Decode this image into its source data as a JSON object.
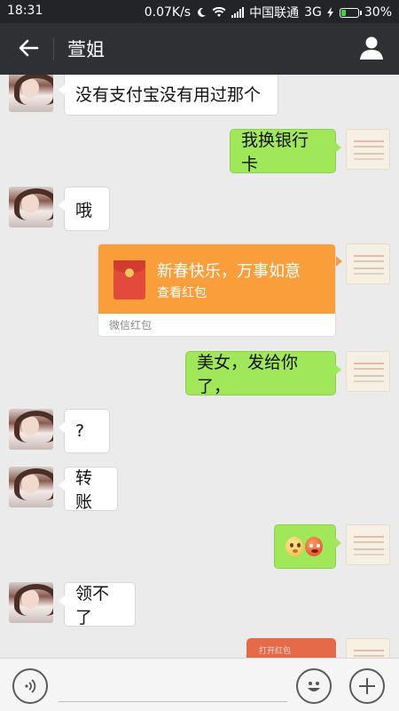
{
  "status_bar": {
    "time": "18:31",
    "network_speed": "0.07K/s",
    "carrier": "中国联通",
    "network_type": "3G",
    "battery": "30%",
    "battery_level": 0.3
  },
  "header": {
    "title": "萱姐",
    "back_icon": "arrow-left-icon",
    "profile_icon": "person-icon"
  },
  "messages": [
    {
      "from": "contact",
      "text": "没有支付宝没有用过那个"
    },
    {
      "from": "self",
      "text": "我换银行卡"
    },
    {
      "from": "contact",
      "text": "哦"
    },
    {
      "from": "self",
      "type": "red_packet",
      "title": "新春快乐，万事如意",
      "subtitle": "查看红包",
      "footer": "微信红包"
    },
    {
      "from": "self",
      "text": "美女，发给你了，"
    },
    {
      "from": "contact",
      "text": "?"
    },
    {
      "from": "contact",
      "text": "转账"
    },
    {
      "from": "self",
      "type": "emoji",
      "emojis": [
        "sweat-face-emoji",
        "angry-face-emoji"
      ]
    },
    {
      "from": "contact",
      "text": "领不了"
    },
    {
      "from": "self",
      "type": "red_packet_partial",
      "text": "打开红包"
    }
  ],
  "input_bar": {
    "voice_icon": "voice-icon",
    "emoji_icon": "smiley-icon",
    "more_icon": "plus-icon"
  },
  "colors": {
    "status_bar_bg": "#232428",
    "title_bar_bg": "#2e3033",
    "chat_bg": "#ebebeb",
    "outgoing_bubble": "#a0e75a",
    "incoming_bubble": "#ffffff",
    "red_packet": "#fa9d3b"
  }
}
